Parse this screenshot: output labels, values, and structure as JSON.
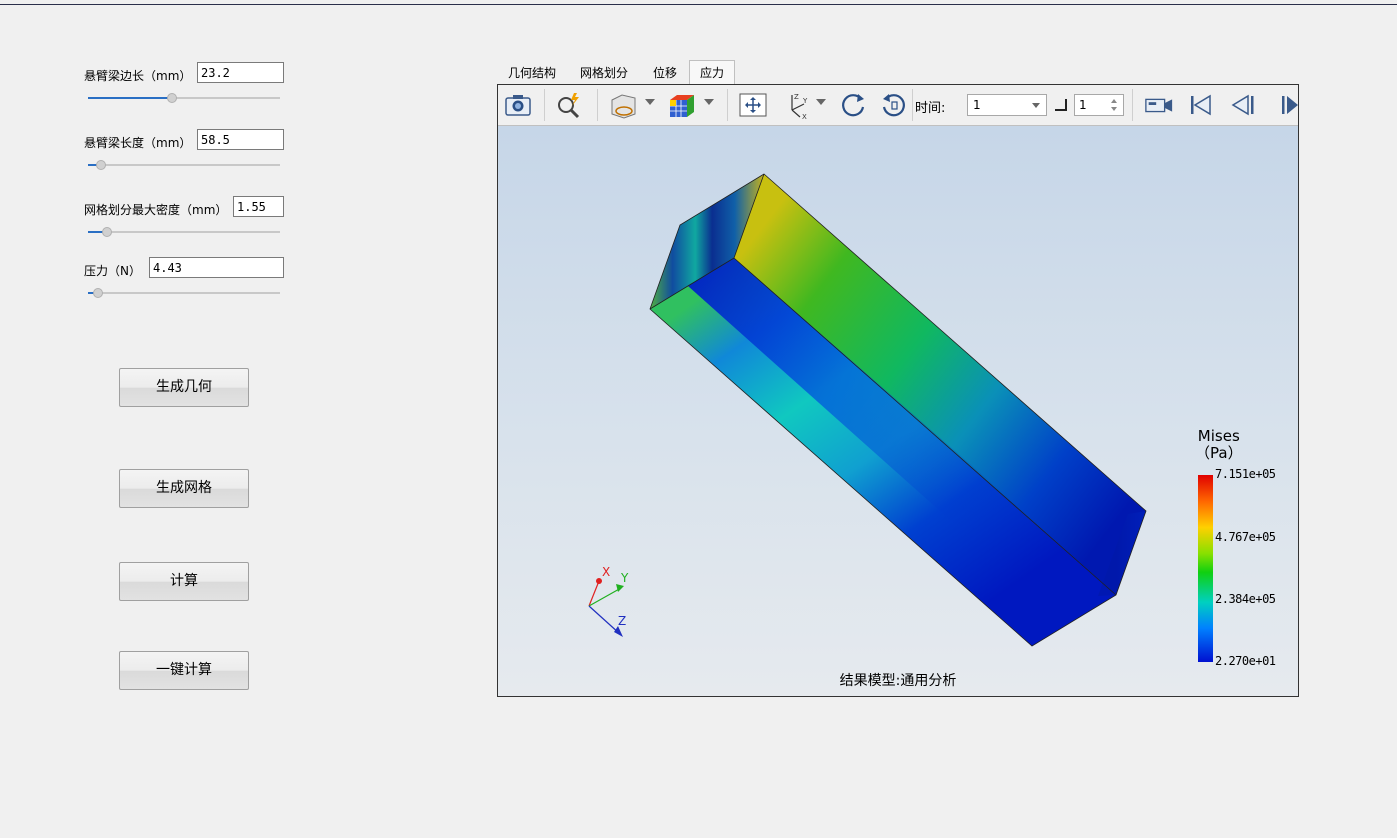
{
  "params": [
    {
      "label": "悬臂梁边长（mm）",
      "value": "23.2",
      "slider_fraction": 0.44
    },
    {
      "label": "悬臂梁长度（mm）",
      "value": "58.5",
      "slider_fraction": 0.07
    },
    {
      "label": "网格划分最大密度（mm）",
      "value": "1.55",
      "slider_fraction": 0.1
    },
    {
      "label": "压力（N）",
      "value": "4.43",
      "slider_fraction": 0.05
    }
  ],
  "buttons": {
    "generate_geometry": "生成几何",
    "generate_mesh": "生成网格",
    "compute": "计算",
    "one_click_compute": "一键计算"
  },
  "tabs": [
    {
      "label": "几何结构",
      "active": false
    },
    {
      "label": "网格划分",
      "active": false
    },
    {
      "label": "位移",
      "active": false
    },
    {
      "label": "应力",
      "active": true
    }
  ],
  "toolbar": {
    "time_label": "时间:",
    "time_value": "1",
    "step_value": "1",
    "icons": [
      "camera-icon",
      "zoom-icon",
      "view-cube-icon",
      "mesh-cube-icon",
      "fit-view-icon",
      "axis-icon",
      "rotate-cw-icon",
      "rotate-ccw-icon",
      "record-icon",
      "first-frame-icon",
      "prev-frame-icon",
      "next-frame-icon"
    ]
  },
  "triad": {
    "x": "X",
    "y": "Y",
    "z": "Z"
  },
  "legend": {
    "title": "Mises",
    "unit": "（Pa）",
    "values": [
      "7.151e+05",
      "4.767e+05",
      "2.384e+05",
      "2.270e+01"
    ]
  },
  "status": "结果模型:通用分析",
  "colors": {
    "accent": "#2a6fc4",
    "stress_high": "#e00000",
    "stress_low": "#0010d0"
  }
}
